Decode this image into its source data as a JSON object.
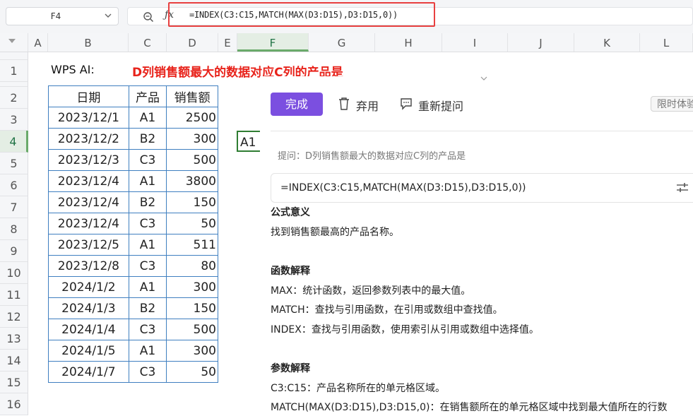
{
  "formula_bar": {
    "name_box": "F4",
    "formula": "=INDEX(C3:C15,MATCH(MAX(D3:D15),D3:D15,0))"
  },
  "sheet": {
    "columns": [
      "A",
      "B",
      "C",
      "D",
      "E",
      "F",
      "G",
      "H",
      "I",
      "J",
      "K",
      "L"
    ],
    "selected_column": "F",
    "rows": [
      "1",
      "2",
      "3",
      "4",
      "5",
      "6",
      "7",
      "8",
      "9",
      "10",
      "11",
      "12",
      "13",
      "14",
      "15",
      "16"
    ],
    "selected_row": "4",
    "a1_label": "WPS AI:",
    "question": "D列销售额最大的数据对应C列的产品是",
    "table": {
      "headers": [
        "日期",
        "产品",
        "销售额"
      ],
      "rows": [
        [
          "2023/12/1",
          "A1",
          "2500"
        ],
        [
          "2023/12/2",
          "B2",
          "300"
        ],
        [
          "2023/12/3",
          "C3",
          "500"
        ],
        [
          "2023/12/4",
          "A1",
          "3800"
        ],
        [
          "2023/12/4",
          "B2",
          "150"
        ],
        [
          "2023/12/4",
          "C3",
          "50"
        ],
        [
          "2023/12/5",
          "A1",
          "511"
        ],
        [
          "2023/12/8",
          "C3",
          "80"
        ],
        [
          "2024/1/2",
          "A1",
          "300"
        ],
        [
          "2024/1/3",
          "B2",
          "150"
        ],
        [
          "2024/1/4",
          "C3",
          "500"
        ],
        [
          "2024/1/5",
          "A1",
          "300"
        ],
        [
          "2024/1/7",
          "C3",
          "50"
        ]
      ]
    },
    "selected_cell_value": "A1"
  },
  "ai_panel": {
    "done_label": "完成",
    "discard_label": "弃用",
    "reask_label": "重新提问",
    "badge_label": "限时体验",
    "prompt": "提问：D列销售额最大的数据对应C列的产品是",
    "formula": "=INDEX(C3:C15,MATCH(MAX(D3:D15),D3:D15,0))",
    "meaning_title": "公式意义",
    "meaning": "找到销售额最高的产品名称。",
    "functions_title": "函数解释",
    "functions": [
      "MAX：统计函数，返回参数列表中的最大值。",
      "MATCH：查找与引用函数，在引用或数组中查找值。",
      "INDEX：查找与引用函数，使用索引从引用或数组中选择值。"
    ],
    "params_title": "参数解释",
    "params": [
      "C3:C15：产品名称所在的单元格区域。",
      "MATCH(MAX(D3:D15),D3:D15,0)：在销售额所在的单元格区域中找到最大值所在的行数"
    ]
  },
  "colors": {
    "accent": "#7b4fe0",
    "question_red": "#e8231b",
    "selection_green": "#2f7d32",
    "table_border": "#3f7fc0"
  }
}
